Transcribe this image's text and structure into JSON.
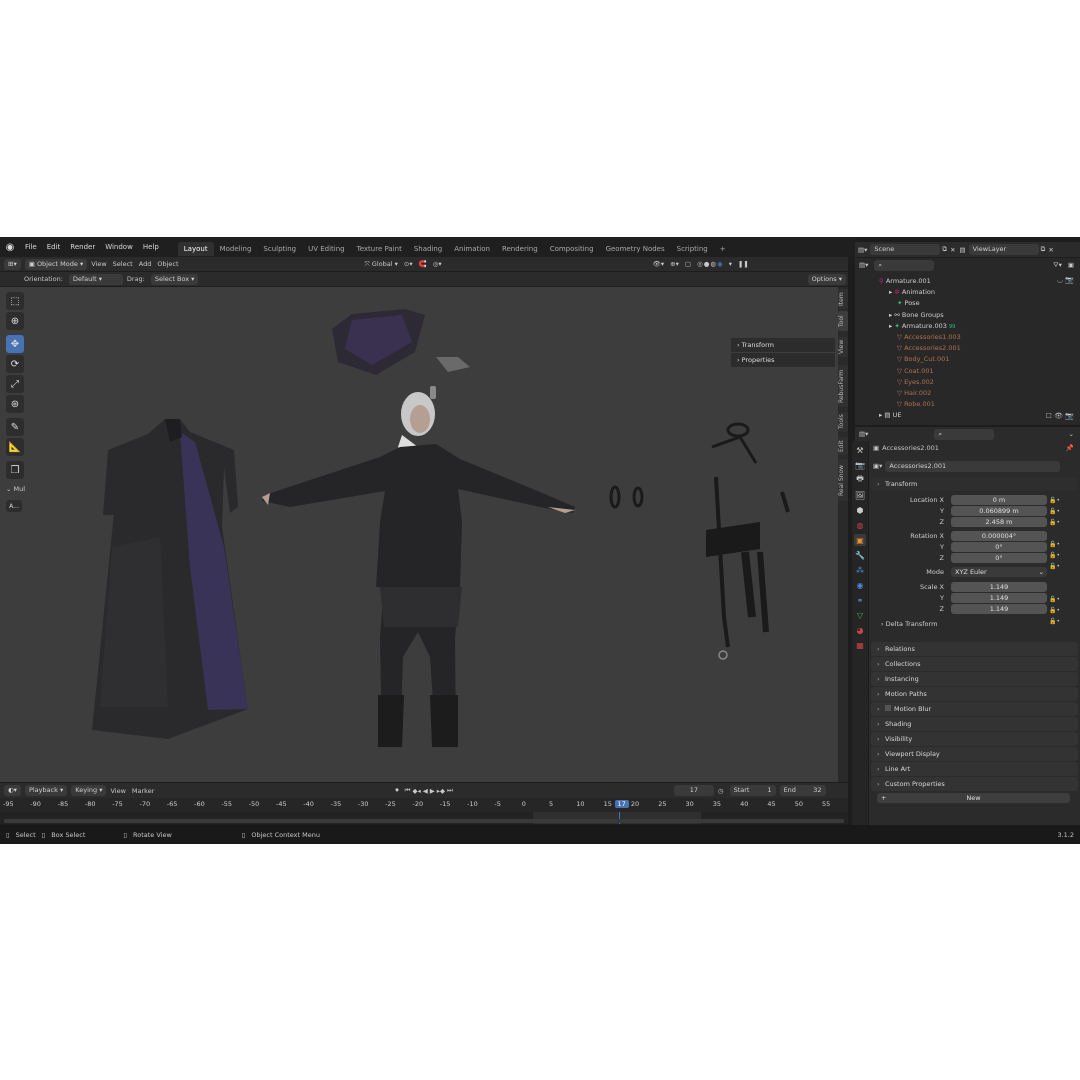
{
  "menu": [
    "File",
    "Edit",
    "Render",
    "Window",
    "Help"
  ],
  "workspaces": [
    "Layout",
    "Modeling",
    "Sculpting",
    "UV Editing",
    "Texture Paint",
    "Shading",
    "Animation",
    "Rendering",
    "Compositing",
    "Geometry Nodes",
    "Scripting"
  ],
  "workspace_add": "+",
  "viewport_header": {
    "mode": "Object Mode",
    "menus": [
      "View",
      "Select",
      "Add",
      "Object"
    ],
    "transform_orientation": "Global"
  },
  "tool_settings": {
    "orientation_label": "Orientation:",
    "orientation_value": "Default",
    "drag_label": "Drag:",
    "drag_value": "Select Box",
    "options": "Options"
  },
  "toolbar_extra": {
    "mode_label": "Mul",
    "adjust_label": "A..."
  },
  "npanel": {
    "rows": [
      "Transform",
      "Properties"
    ],
    "tabs": [
      "Item",
      "Tool",
      "View",
      "RebusFarm",
      "Tools",
      "Edit",
      "Real Snow"
    ]
  },
  "timeline": {
    "menus": [
      "Playback",
      "Keying",
      "View",
      "Marker"
    ],
    "current_frame": "17",
    "start_label": "Start",
    "start": "1",
    "end_label": "End",
    "end": "32",
    "ticks": [
      "-95",
      "-90",
      "-85",
      "-80",
      "-75",
      "-70",
      "-65",
      "-60",
      "-55",
      "-50",
      "-45",
      "-40",
      "-35",
      "-30",
      "-25",
      "-20",
      "-15",
      "-10",
      "-5",
      "0",
      "5",
      "10",
      "15",
      "17",
      "20",
      "25",
      "30",
      "35",
      "40",
      "45",
      "50",
      "55"
    ]
  },
  "statusbar": {
    "select": "Select",
    "box_select": "Box Select",
    "rotate_view": "Rotate View",
    "context_menu": "Object Context Menu",
    "version": "3.1.2"
  },
  "outliner": {
    "scene": "Scene",
    "view_layer": "ViewLayer",
    "rows": [
      {
        "label": "Armature.001",
        "dim": false
      },
      {
        "label": "Animation",
        "dim": false
      },
      {
        "label": "Pose",
        "dim": false
      },
      {
        "label": "Bone Groups",
        "dim": false
      },
      {
        "label": "Armature.003",
        "dim": false
      },
      {
        "label": "Accessories1.003",
        "dim": true
      },
      {
        "label": "Accessories2.001",
        "dim": true
      },
      {
        "label": "Body_Cut.001",
        "dim": true
      },
      {
        "label": "Coat.001",
        "dim": true
      },
      {
        "label": "Eyes.002",
        "dim": true
      },
      {
        "label": "Hair.002",
        "dim": true
      },
      {
        "label": "Robe.001",
        "dim": true
      },
      {
        "label": "UE",
        "dim": false
      }
    ],
    "armature_badge": "99"
  },
  "properties": {
    "active_object": "Accessories2.001",
    "object_name": "Accessories2.001",
    "transform_title": "Transform",
    "location": {
      "label": "Location X",
      "x": "0 m",
      "y": "0.060899 m",
      "z": "2.458 m"
    },
    "rotation": {
      "label": "Rotation X",
      "x": "0.000004°",
      "y": "0°",
      "z": "0°"
    },
    "mode_label": "Mode",
    "mode_value": "XYZ Euler",
    "scale": {
      "label": "Scale X",
      "x": "1.149",
      "y": "1.149",
      "z": "1.149"
    },
    "axis": {
      "y": "Y",
      "z": "Z"
    },
    "delta": "Delta Transform",
    "sections": [
      "Relations",
      "Collections",
      "Instancing",
      "Motion Paths",
      "Motion Blur",
      "Shading",
      "Visibility",
      "Viewport Display",
      "Line Art",
      "Custom Properties"
    ],
    "new_button": "New"
  },
  "colors": {
    "accent": "#4772b3",
    "viewport_bg": "#3d3d3d",
    "ui_bg": "#1d1d1d"
  }
}
